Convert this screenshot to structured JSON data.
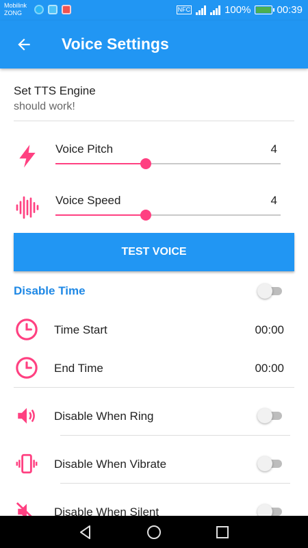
{
  "status_bar": {
    "carrier_line1": "Mobilink",
    "carrier_line2": "ZONG",
    "nfc": "NFC",
    "battery": "100%",
    "time": "00:39",
    "battery_level": 1.0
  },
  "app_bar": {
    "title": "Voice Settings",
    "back_icon": "arrow-back-icon"
  },
  "tts": {
    "label": "Set TTS Engine",
    "value": "should work!"
  },
  "pitch": {
    "label": "Voice Pitch",
    "value": "4",
    "fraction": 0.4,
    "icon": "lightning-icon"
  },
  "speed": {
    "label": "Voice Speed",
    "value": "4",
    "fraction": 0.4,
    "icon": "soundwave-icon"
  },
  "test_button": "TEST VOICE",
  "disable_time": {
    "title": "Disable Time",
    "enabled": false
  },
  "time_start": {
    "label": "Time Start",
    "value": "00:00",
    "icon": "clock-icon"
  },
  "end_time": {
    "label": "End Time",
    "value": "00:00",
    "icon": "clock-icon"
  },
  "disable_ring": {
    "label": "Disable When Ring",
    "enabled": false,
    "icon": "speaker-volume-icon"
  },
  "disable_vibrate": {
    "label": "Disable When Vibrate",
    "enabled": false,
    "icon": "phone-vibrate-icon"
  },
  "disable_silent": {
    "label": "Disable When Silent",
    "enabled": false,
    "icon": "speaker-mute-icon"
  },
  "colors": {
    "primary": "#2196F3",
    "accent": "#FF4081",
    "section_title": "#1E88E5"
  }
}
